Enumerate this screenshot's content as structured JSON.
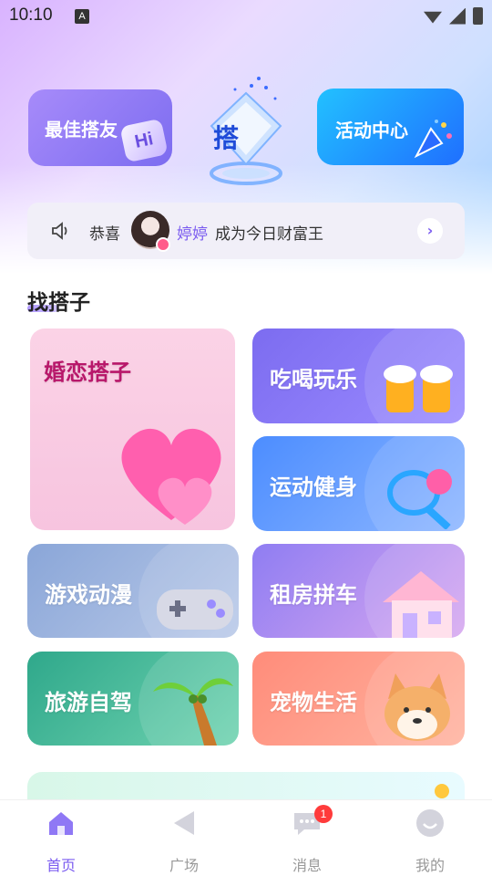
{
  "status_bar": {
    "time": "10:10",
    "notification_icon_letter": "A"
  },
  "top_cards": {
    "left": {
      "label": "最佳搭友",
      "badge_text": "Hi"
    },
    "center": {
      "logo_text": "搭"
    },
    "right": {
      "label": "活动中心"
    }
  },
  "notice": {
    "prefix": "恭喜",
    "name": "婷婷",
    "suffix": "成为今日财富王",
    "arrow": "›"
  },
  "section": {
    "title": "找搭子"
  },
  "categories": [
    {
      "label": "婚恋搭子"
    },
    {
      "label": "吃喝玩乐"
    },
    {
      "label": "运动健身"
    },
    {
      "label": "游戏动漫"
    },
    {
      "label": "租房拼车"
    },
    {
      "label": "旅游自驾"
    },
    {
      "label": "宠物生活"
    }
  ],
  "tabbar": {
    "items": [
      {
        "label": "首页",
        "icon": "home-icon",
        "active": true
      },
      {
        "label": "广场",
        "icon": "plaza-icon"
      },
      {
        "label": "消息",
        "icon": "message-icon",
        "badge": "1"
      },
      {
        "label": "我的",
        "icon": "profile-icon"
      }
    ]
  },
  "colors": {
    "accent": "#7b5cf0",
    "badge": "#ff3b3b"
  }
}
